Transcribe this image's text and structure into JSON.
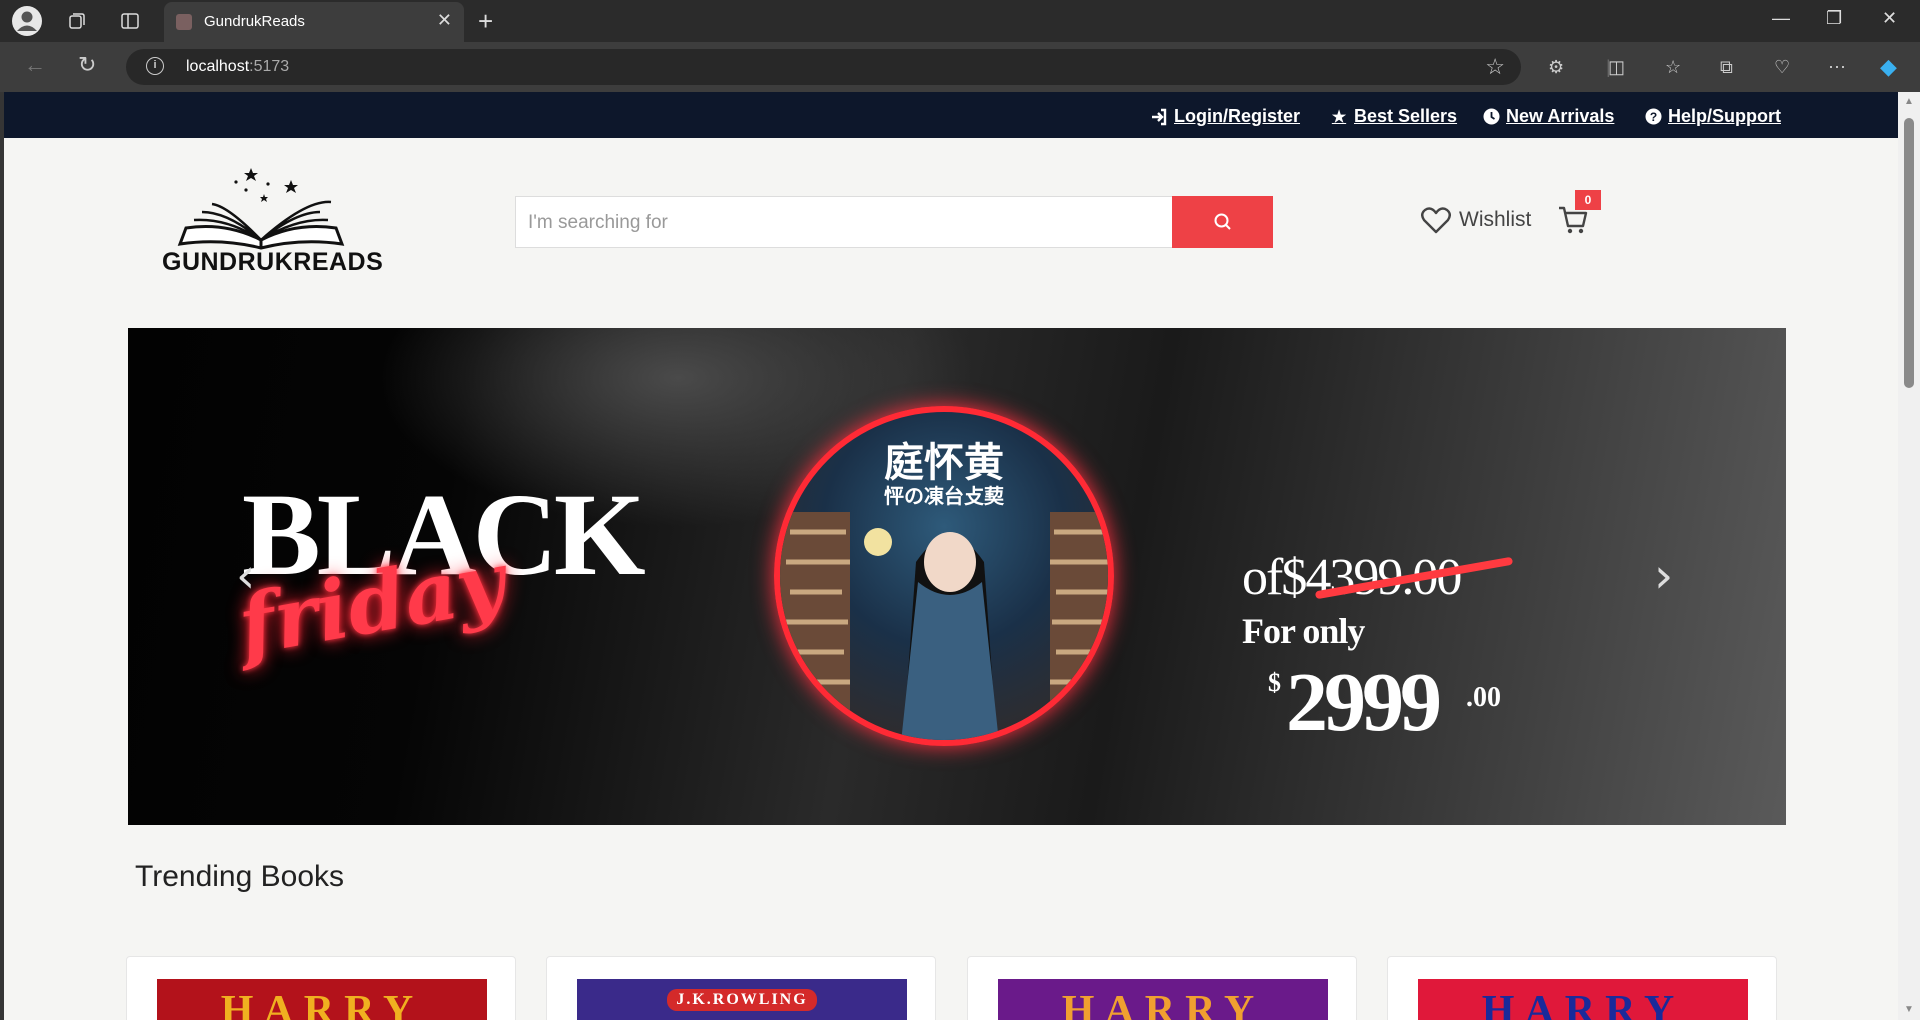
{
  "browser": {
    "tab_title": "GundrukReads",
    "url_host": "localhost",
    "url_port": ":5173"
  },
  "topbar": {
    "links": [
      {
        "label": "Login/Register",
        "icon": "sign-in-icon"
      },
      {
        "label": "Best Sellers",
        "icon": "star-icon"
      },
      {
        "label": "New Arrivals",
        "icon": "clock-icon"
      },
      {
        "label": "Help/Support",
        "icon": "question-circle-icon"
      }
    ]
  },
  "header": {
    "brand": "GUNDRUKREADS",
    "search_placeholder": "I'm searching for",
    "wishlist_label": "Wishlist",
    "cart_count": "0"
  },
  "banner": {
    "headline": "BLACK",
    "subheadline": "friday",
    "cover_title": "庭怀黄",
    "cover_subtitle": "怦の凍台攴葜",
    "original_price": "of$4399.00",
    "offer_label": "For only",
    "currency": "$",
    "price": "2999",
    "price_cents": ".00"
  },
  "trending": {
    "heading": "Trending Books",
    "cards": [
      {
        "cover_text": "HARRY",
        "bg": "#b3121b",
        "fg": "#f0b020"
      },
      {
        "cover_text": "J.K.ROWLING",
        "bg": "#3a2a8a",
        "fg": "#ffffff"
      },
      {
        "cover_text": "HARRY",
        "bg": "#6a1a8a",
        "fg": "#f0a030"
      },
      {
        "cover_text": "HARRY",
        "bg": "#e0183a",
        "fg": "#1a2a9a"
      }
    ]
  },
  "colors": {
    "accent": "#ee4146",
    "topbar": "#0d172b"
  }
}
